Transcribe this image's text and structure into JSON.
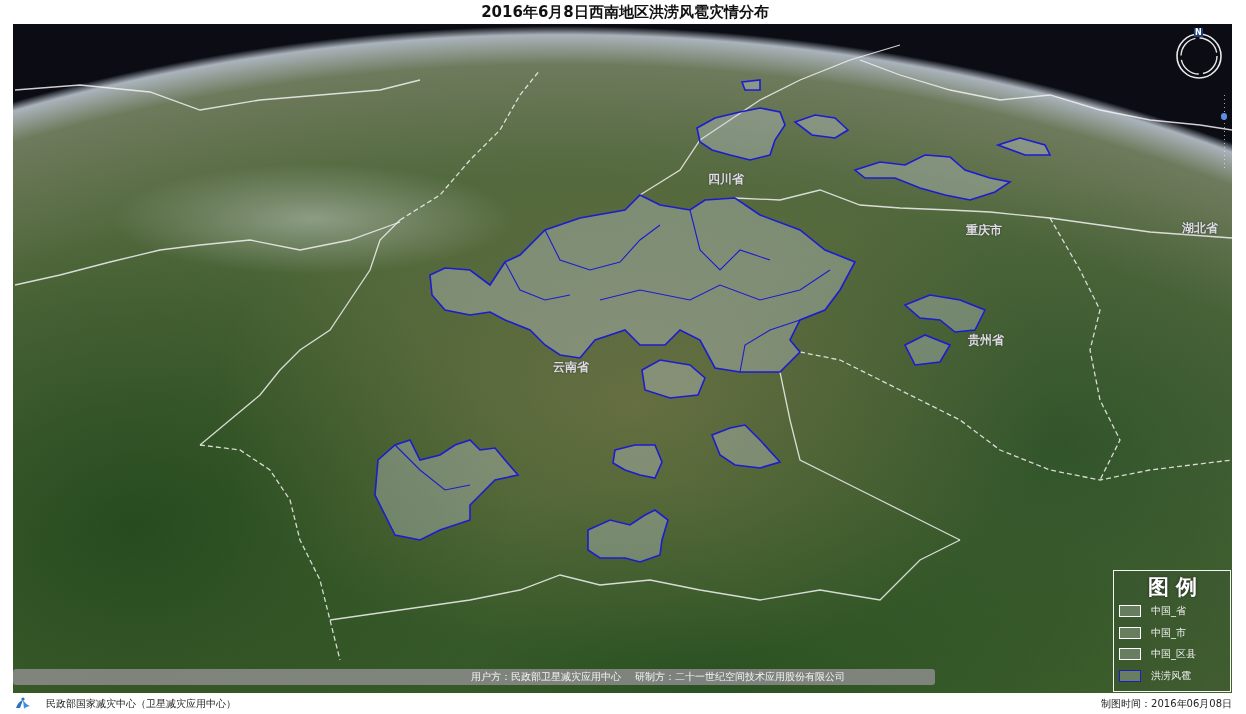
{
  "title": "2016年6月8日西南地区洪涝风雹灾情分布",
  "map": {
    "labels": [
      "四川省",
      "重庆市",
      "湖北省",
      "贵州省",
      "云南省"
    ],
    "compass": {
      "north": "N"
    },
    "zoom_slider": {
      "level": 0.72
    },
    "credits": [
      "用户方：民政部卫星减灾应用中心",
      "研制方：二十一世纪空间技术应用股份有限公司"
    ]
  },
  "legend": {
    "title": "图 例",
    "items": [
      {
        "label": "中国_省",
        "color": "#ffffff"
      },
      {
        "label": "中国_市",
        "color": "#ffffff"
      },
      {
        "label": "中国_区县",
        "color": "#ffffff"
      },
      {
        "label": "洪涝风雹",
        "color": "#1c1cd0"
      }
    ]
  },
  "footer": {
    "organization": "民政部国家减灾中心（卫星减灾应用中心）",
    "date": "制图时间：2016年06月08日"
  }
}
